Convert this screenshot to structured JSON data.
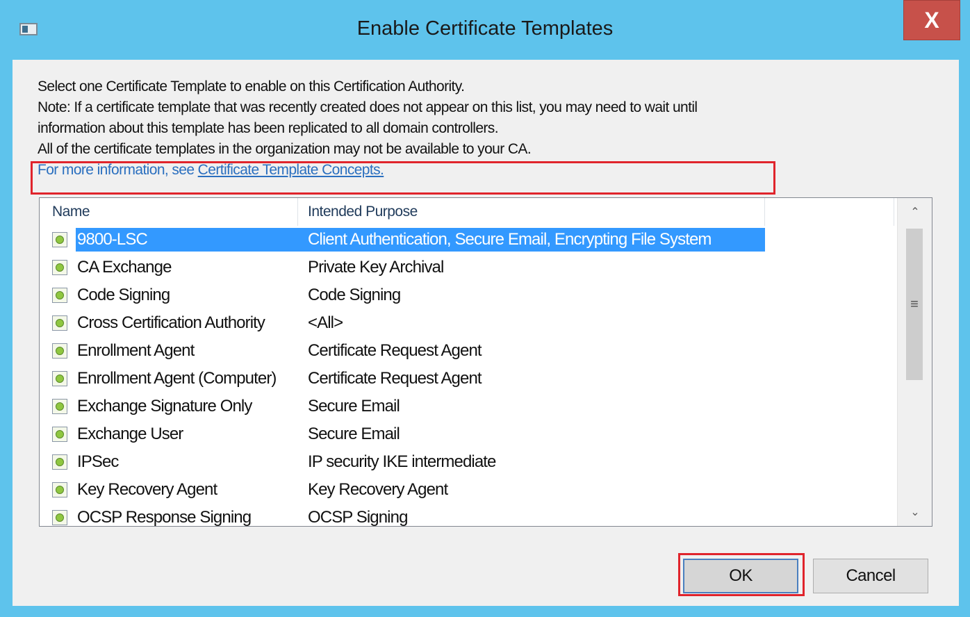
{
  "window": {
    "title": "Enable Certificate Templates",
    "close_label": "X"
  },
  "description": {
    "line1": "Select one Certificate Template to enable on this Certification Authority.",
    "line2": "Note: If a certificate template that was recently created does not appear on this list, you may need to wait until",
    "line3": "information about this template has been replicated to all domain controllers.",
    "line4": "All of the certificate templates in the organization may not be available to your CA.",
    "more_prefix": "For more information, see ",
    "more_link": "Certificate Template Concepts."
  },
  "list": {
    "columns": [
      "Name",
      "Intended Purpose"
    ],
    "rows": [
      {
        "name": "9800-LSC",
        "purpose": "Client Authentication, Secure Email, Encrypting File System",
        "selected": true
      },
      {
        "name": "CA Exchange",
        "purpose": "Private Key Archival"
      },
      {
        "name": "Code Signing",
        "purpose": "Code Signing"
      },
      {
        "name": "Cross Certification Authority",
        "purpose": "<All>"
      },
      {
        "name": "Enrollment Agent",
        "purpose": "Certificate Request Agent"
      },
      {
        "name": "Enrollment Agent (Computer)",
        "purpose": "Certificate Request Agent"
      },
      {
        "name": "Exchange Signature Only",
        "purpose": "Secure Email"
      },
      {
        "name": "Exchange User",
        "purpose": "Secure Email"
      },
      {
        "name": "IPSec",
        "purpose": "IP security IKE intermediate"
      },
      {
        "name": "Key Recovery Agent",
        "purpose": "Key Recovery Agent"
      },
      {
        "name": "OCSP Response Signing",
        "purpose": "OCSP Signing"
      }
    ],
    "icon": "certificate-template-icon"
  },
  "buttons": {
    "ok": "OK",
    "cancel": "Cancel"
  },
  "colors": {
    "titlebar": "#5ec3ec",
    "selection": "#3399ff",
    "close": "#c7514a",
    "highlight": "#e0242c"
  }
}
